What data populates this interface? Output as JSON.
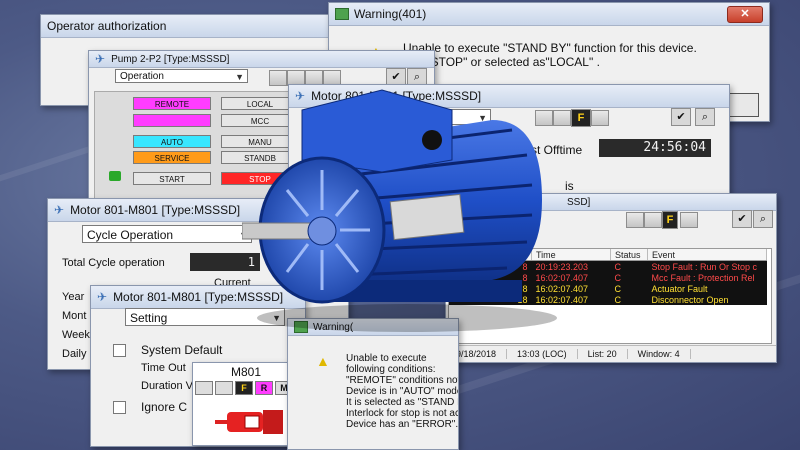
{
  "op_auth": {
    "title": "Operator authorization"
  },
  "warning401": {
    "title": "Warning(401)",
    "line1": "Unable to execute \"STAND BY\" function for this device.",
    "line2": "t be \"STOP\" or selected as\"LOCAL\" ."
  },
  "pump": {
    "title": "Pump 2-P2  [Type:MSSSD]",
    "dropdown": "Operation",
    "buttons": {
      "remote": "REMOTE",
      "blank": "",
      "auto": "AUTO",
      "service": "SERVICE",
      "start": "START",
      "local": "LOCAL",
      "mcc": "MCC",
      "manual": "MANU",
      "standby": "STANDB",
      "stop": "STOP"
    }
  },
  "motor_top": {
    "title": "Motor 801-M801  [Type:MSSSD]",
    "flag": "F",
    "offtime_label": "st Offtime",
    "offtime_value": "24:56:04",
    "partial": "is"
  },
  "events": {
    "title": "SSD]",
    "flag": "F",
    "headers": {
      "time": "Time",
      "status": "Status",
      "event": "Event"
    },
    "rows": [
      {
        "left": "8",
        "time": "20:19:23.203",
        "status": "C",
        "event": "Stop Fault : Run Or Stop c",
        "color": "#ff4a4a"
      },
      {
        "left": "8",
        "time": "16:02:07.407",
        "status": "C",
        "event": "Mcc Fault : Protection Rel",
        "color": "#ff4a4a"
      },
      {
        "left": "8",
        "time": "16:02:07.407",
        "status": "C",
        "event": "Actuator Fault",
        "color": "#ffe033"
      },
      {
        "left": "18",
        "time": "16:02:07.407",
        "status": "C",
        "event": "Disconnector Open",
        "color": "#ffe033"
      }
    ],
    "status": {
      "date": "9/18/2018",
      "time": "13:03 (LOC)",
      "list": "List: 20",
      "window": "Window: 4"
    }
  },
  "motor_cycle": {
    "title": "Motor 801-M801  [Type:MSSSD]",
    "dropdown": "Cycle Operation",
    "total_label": "Total Cycle operation",
    "total_value": "1",
    "current_label": "Current",
    "row_year": "Year",
    "row_month": "Mont",
    "row_week": "Week",
    "row_daily": "Daily"
  },
  "motor_setting": {
    "title": "Motor 801-M801  [Type:MSSSD]",
    "dropdown": "Setting",
    "system_default": "System Default",
    "timeout": "Time Out",
    "duration": "Duration V",
    "ignore": "Ignore C"
  },
  "faceplate": {
    "name": "M801",
    "flags": {
      "f": "F",
      "r": "R",
      "m": "M",
      "s": "S"
    }
  },
  "warning2": {
    "title": "Warning(",
    "lines": [
      "Unable to execute",
      "following conditions:",
      "\"REMOTE\" conditions not selected.",
      "Device is in \"AUTO\" mode.",
      "It is selected as \"STAND BY\" device.",
      "Interlock for stop is not active.",
      "Device has an \"ERROR\"."
    ]
  }
}
